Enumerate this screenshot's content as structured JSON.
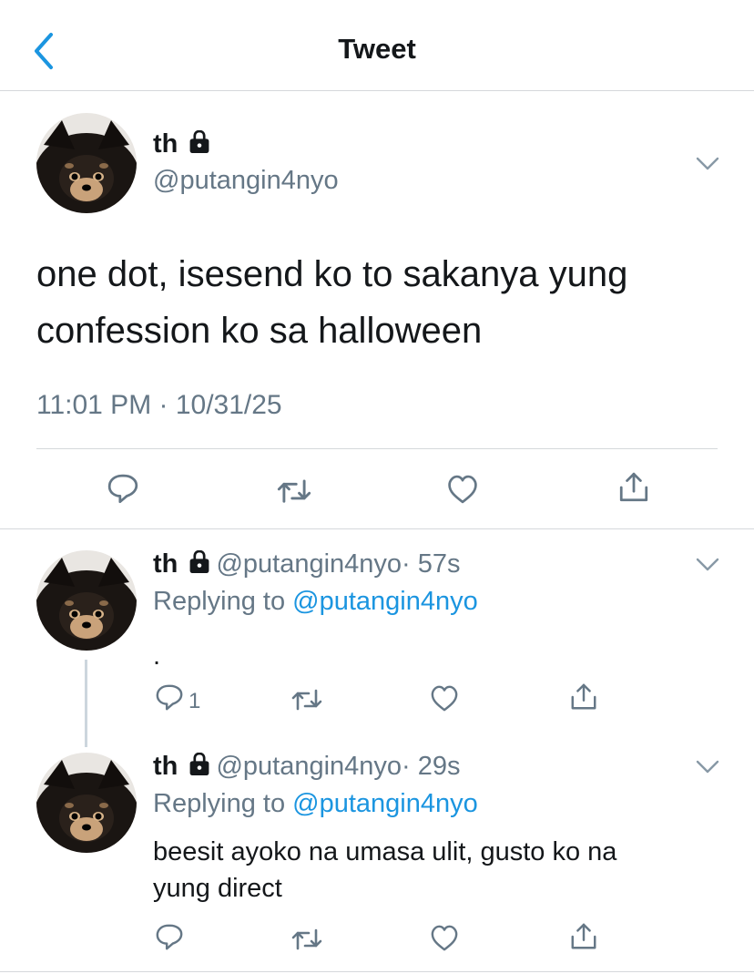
{
  "header": {
    "title": "Tweet",
    "back_icon": "chevron-left-icon"
  },
  "tweet": {
    "display_name": "th",
    "handle": "@putangin4nyo",
    "protected_icon": "lock-icon",
    "text_line1": "one dot, isesend ko to sakanya yung",
    "text_line2": "confession ko sa halloween",
    "timestamp": "11:01 PM · 10/31/25",
    "actions": [
      "reply-icon",
      "retweet-icon",
      "like-icon",
      "share-icon"
    ]
  },
  "replies": [
    {
      "display_name": "th",
      "handle": "@putangin4nyo",
      "time": "· 57s",
      "replying_label": "Replying to",
      "replying_handle": "@putangin4nyo",
      "text": ".",
      "reply_count": "1"
    },
    {
      "display_name": "th",
      "handle": "@putangin4nyo",
      "time": "· 29s",
      "replying_label": "Replying to",
      "replying_handle": "@putangin4nyo",
      "text_line1": "beesit ayoko na umasa ulit, gusto ko na",
      "text_line2": "yung direct",
      "reply_count": ""
    }
  ],
  "colors": {
    "accent": "#1b95e0",
    "secondary_text": "#657786",
    "separator": "#d5d8db",
    "icon": "#657786"
  }
}
